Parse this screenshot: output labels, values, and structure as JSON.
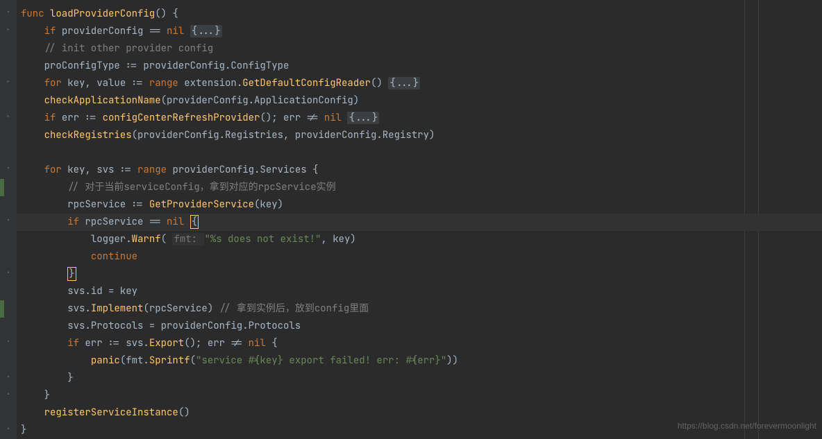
{
  "code": {
    "l1": {
      "kw1": "func ",
      "fn": "loadProviderConfig",
      "rest": "() {"
    },
    "l2": {
      "kw1": "if ",
      "id": "providerConfig == ",
      "kw2": "nil ",
      "fold": "{...}"
    },
    "l3": {
      "cm": "// init other provider config"
    },
    "l4": {
      "a": "proConfigType := providerConfig.ConfigType"
    },
    "l5": {
      "kw1": "for ",
      "a": "key, value := ",
      "kw2": "range ",
      "b": "extension.",
      "fn": "GetDefaultConfigReader",
      "c": "() ",
      "fold": "{...}"
    },
    "l6": {
      "fn": "checkApplicationName",
      "a": "(providerConfig.ApplicationConfig)"
    },
    "l7": {
      "kw1": "if ",
      "a": "err := ",
      "fn": "configCenterRefreshProvider",
      "b": "(); err != ",
      "kw2": "nil ",
      "fold": "{...}"
    },
    "l8": {
      "fn": "checkRegistries",
      "a": "(providerConfig.Registries, providerConfig.Registry)"
    },
    "l9": {
      "blank": " "
    },
    "l10": {
      "kw1": "for ",
      "a": "key, svs := ",
      "kw2": "range ",
      "b": "providerConfig.Services {"
    },
    "l11": {
      "cm": "// 对于当前serviceConfig，拿到对应的rpcService实例"
    },
    "l12": {
      "a": "rpcService := ",
      "fn": "GetProviderService",
      "b": "(key)"
    },
    "l13": {
      "kw1": "if ",
      "a": "rpcService == ",
      "kw2": "nil ",
      "brace": "{"
    },
    "l14": {
      "a": "logger.",
      "fn": "Warnf",
      "b": "( ",
      "hint": "fmt: ",
      "str": "\"%s does not exist!\"",
      "c": ", key)"
    },
    "l15": {
      "kw": "continue"
    },
    "l16": {
      "brace": "}"
    },
    "l17": {
      "a": "svs.id = key"
    },
    "l18": {
      "a": "svs.",
      "fn": "Implement",
      "b": "(rpcService) ",
      "cm": "// 拿到实例后，放到config里面"
    },
    "l19": {
      "a": "svs.Protocols = providerConfig.Protocols"
    },
    "l20": {
      "kw1": "if ",
      "a": "err := svs.",
      "fn": "Export",
      "b": "(); err != ",
      "kw2": "nil ",
      "c": "{"
    },
    "l21": {
      "fn": "panic",
      "a": "(fmt.",
      "fn2": "Sprintf",
      "b": "(",
      "str": "\"service #{key} export failed! err: #{err}\"",
      "c": "))"
    },
    "l22": {
      "a": "}"
    },
    "l23": {
      "a": "}"
    },
    "l24": {
      "fn": "registerServiceInstance",
      "a": "()"
    },
    "l25": {
      "a": "}"
    }
  },
  "indent": {
    "i0": "",
    "i1": "    ",
    "i2": "        ",
    "i3": "            "
  },
  "watermark": "https://blog.csdn.net/forevermoonlight"
}
